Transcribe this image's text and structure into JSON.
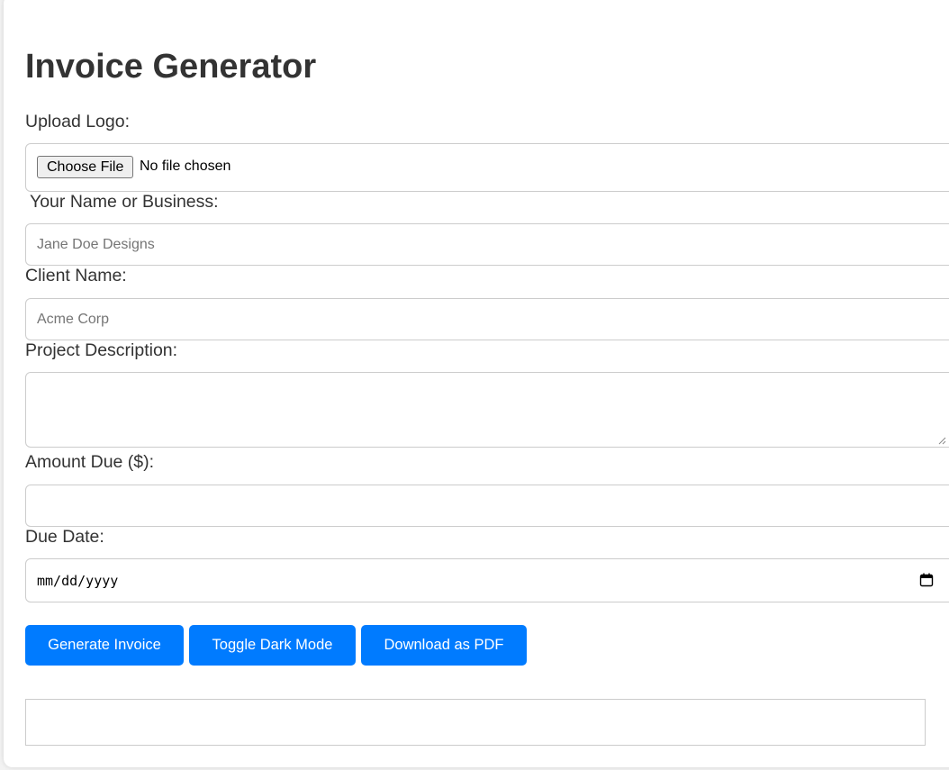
{
  "page": {
    "title": "Invoice Generator"
  },
  "form": {
    "logo": {
      "label": "Upload Logo:",
      "button_label": "Choose File",
      "status": "No file chosen"
    },
    "business_name": {
      "label": "Your Name or Business:",
      "placeholder": "Jane Doe Designs",
      "value": ""
    },
    "client_name": {
      "label": "Client Name:",
      "placeholder": "Acme Corp",
      "value": ""
    },
    "project_description": {
      "label": "Project Description:",
      "value": ""
    },
    "amount_due": {
      "label": "Amount Due ($):",
      "value": ""
    },
    "due_date": {
      "label": "Due Date:",
      "value_placeholder": "mm/dd/yyyy",
      "icon": "calendar-icon"
    }
  },
  "actions": {
    "generate_label": "Generate Invoice",
    "dark_mode_label": "Toggle Dark Mode",
    "pdf_label": "Download as PDF"
  },
  "colors": {
    "accent": "#007bff",
    "text": "#333333",
    "border": "#cccccc"
  }
}
